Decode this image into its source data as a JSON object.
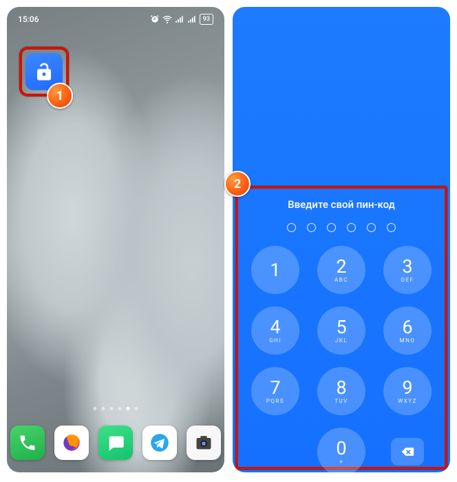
{
  "statusbar": {
    "time": "15:06",
    "battery_text": "93"
  },
  "callouts": {
    "one": "1",
    "two": "2"
  },
  "dock": [
    {
      "name": "phone",
      "bg": "app-phone"
    },
    {
      "name": "firefox",
      "bg": "app-firefox"
    },
    {
      "name": "messages",
      "bg": "app-sms"
    },
    {
      "name": "telegram",
      "bg": "app-telegram"
    },
    {
      "name": "camera",
      "bg": "app-camera"
    }
  ],
  "page_indicator": {
    "count": 6,
    "active": 4
  },
  "pin": {
    "title": "Введите свой пин-код",
    "length": 6,
    "keys": [
      {
        "d": "1",
        "l": ""
      },
      {
        "d": "2",
        "l": "ABC"
      },
      {
        "d": "3",
        "l": "DEF"
      },
      {
        "d": "4",
        "l": "GHI"
      },
      {
        "d": "5",
        "l": "JKL"
      },
      {
        "d": "6",
        "l": "MNO"
      },
      {
        "d": "7",
        "l": "PQRS"
      },
      {
        "d": "8",
        "l": "TUV"
      },
      {
        "d": "9",
        "l": "WXYZ"
      },
      {
        "d": "0",
        "l": "+"
      }
    ]
  }
}
